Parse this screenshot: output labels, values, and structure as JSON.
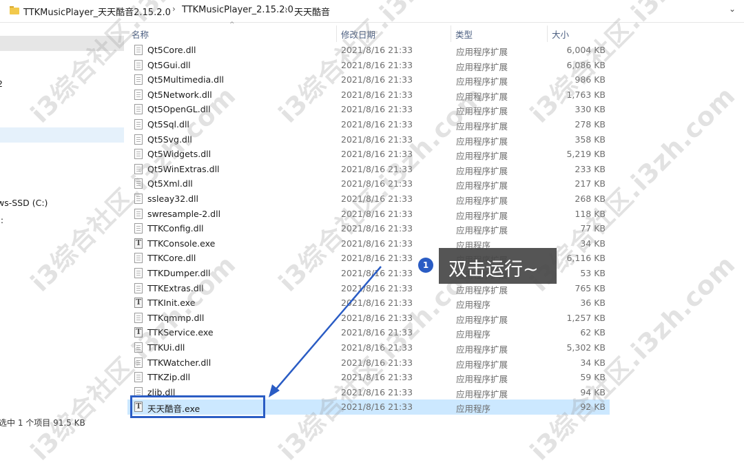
{
  "breadcrumb": {
    "segments": [
      "TTKMusicPlayer_天天酷音2.15.2.0",
      "TTKMusicPlayer_2.15.2.0",
      "天天酷音"
    ],
    "separator": "›",
    "dropdown": "⌄"
  },
  "nav_pane": {
    "items": [
      "",
      "",
      "2",
      "",
      "",
      "",
      "",
      "",
      "ws-SSD (C:)",
      "):"
    ]
  },
  "columns": {
    "name": "名称",
    "date": "修改日期",
    "type": "类型",
    "size": "大小"
  },
  "files": [
    {
      "name": "Qt5Core.dll",
      "date": "2021/8/16 21:33",
      "type": "应用程序扩展",
      "size": "6,004 KB",
      "kind": "dll"
    },
    {
      "name": "Qt5Gui.dll",
      "date": "2021/8/16 21:33",
      "type": "应用程序扩展",
      "size": "6,086 KB",
      "kind": "dll"
    },
    {
      "name": "Qt5Multimedia.dll",
      "date": "2021/8/16 21:33",
      "type": "应用程序扩展",
      "size": "986 KB",
      "kind": "dll"
    },
    {
      "name": "Qt5Network.dll",
      "date": "2021/8/16 21:33",
      "type": "应用程序扩展",
      "size": "1,763 KB",
      "kind": "dll"
    },
    {
      "name": "Qt5OpenGL.dll",
      "date": "2021/8/16 21:33",
      "type": "应用程序扩展",
      "size": "330 KB",
      "kind": "dll"
    },
    {
      "name": "Qt5Sql.dll",
      "date": "2021/8/16 21:33",
      "type": "应用程序扩展",
      "size": "278 KB",
      "kind": "dll"
    },
    {
      "name": "Qt5Svg.dll",
      "date": "2021/8/16 21:33",
      "type": "应用程序扩展",
      "size": "358 KB",
      "kind": "dll"
    },
    {
      "name": "Qt5Widgets.dll",
      "date": "2021/8/16 21:33",
      "type": "应用程序扩展",
      "size": "5,219 KB",
      "kind": "dll"
    },
    {
      "name": "Qt5WinExtras.dll",
      "date": "2021/8/16 21:33",
      "type": "应用程序扩展",
      "size": "233 KB",
      "kind": "dll"
    },
    {
      "name": "Qt5Xml.dll",
      "date": "2021/8/16 21:33",
      "type": "应用程序扩展",
      "size": "217 KB",
      "kind": "dll"
    },
    {
      "name": "ssleay32.dll",
      "date": "2021/8/16 21:33",
      "type": "应用程序扩展",
      "size": "268 KB",
      "kind": "dll"
    },
    {
      "name": "swresample-2.dll",
      "date": "2021/8/16 21:33",
      "type": "应用程序扩展",
      "size": "118 KB",
      "kind": "dll"
    },
    {
      "name": "TTKConfig.dll",
      "date": "2021/8/16 21:33",
      "type": "应用程序扩展",
      "size": "77 KB",
      "kind": "dll"
    },
    {
      "name": "TTKConsole.exe",
      "date": "2021/8/16 21:33",
      "type": "应用程序",
      "size": "34 KB",
      "kind": "exe"
    },
    {
      "name": "TTKCore.dll",
      "date": "2021/8/16 21:33",
      "type": "应用程序扩展",
      "size": "6,116 KB",
      "kind": "dll"
    },
    {
      "name": "TTKDumper.dll",
      "date": "2021/8/16 21:33",
      "type": "应用程序扩展",
      "size": "53 KB",
      "kind": "dll"
    },
    {
      "name": "TTKExtras.dll",
      "date": "2021/8/16 21:33",
      "type": "应用程序扩展",
      "size": "765 KB",
      "kind": "dll"
    },
    {
      "name": "TTKInit.exe",
      "date": "2021/8/16 21:33",
      "type": "应用程序",
      "size": "36 KB",
      "kind": "exe"
    },
    {
      "name": "TTKqmmp.dll",
      "date": "2021/8/16 21:33",
      "type": "应用程序扩展",
      "size": "1,257 KB",
      "kind": "dll"
    },
    {
      "name": "TTKService.exe",
      "date": "2021/8/16 21:33",
      "type": "应用程序",
      "size": "62 KB",
      "kind": "exe"
    },
    {
      "name": "TTKUi.dll",
      "date": "2021/8/16 21:33",
      "type": "应用程序扩展",
      "size": "5,302 KB",
      "kind": "dll"
    },
    {
      "name": "TTKWatcher.dll",
      "date": "2021/8/16 21:33",
      "type": "应用程序扩展",
      "size": "34 KB",
      "kind": "dll"
    },
    {
      "name": "TTKZip.dll",
      "date": "2021/8/16 21:33",
      "type": "应用程序扩展",
      "size": "59 KB",
      "kind": "dll"
    },
    {
      "name": "zlib.dll",
      "date": "2021/8/16 21:33",
      "type": "应用程序扩展",
      "size": "94 KB",
      "kind": "dll"
    },
    {
      "name": "天天酷音.exe",
      "date": "2021/8/16 21:33",
      "type": "应用程序",
      "size": "92 KB",
      "kind": "exe",
      "selected": true
    }
  ],
  "status_bar": {
    "text": "选中 1 个项目 91.5 KB"
  },
  "annotation": {
    "badge": "1",
    "callout": "双击运行~",
    "accent": "#2a5cc4"
  },
  "watermark": {
    "text": "i3综合社区.i3zh.com"
  }
}
